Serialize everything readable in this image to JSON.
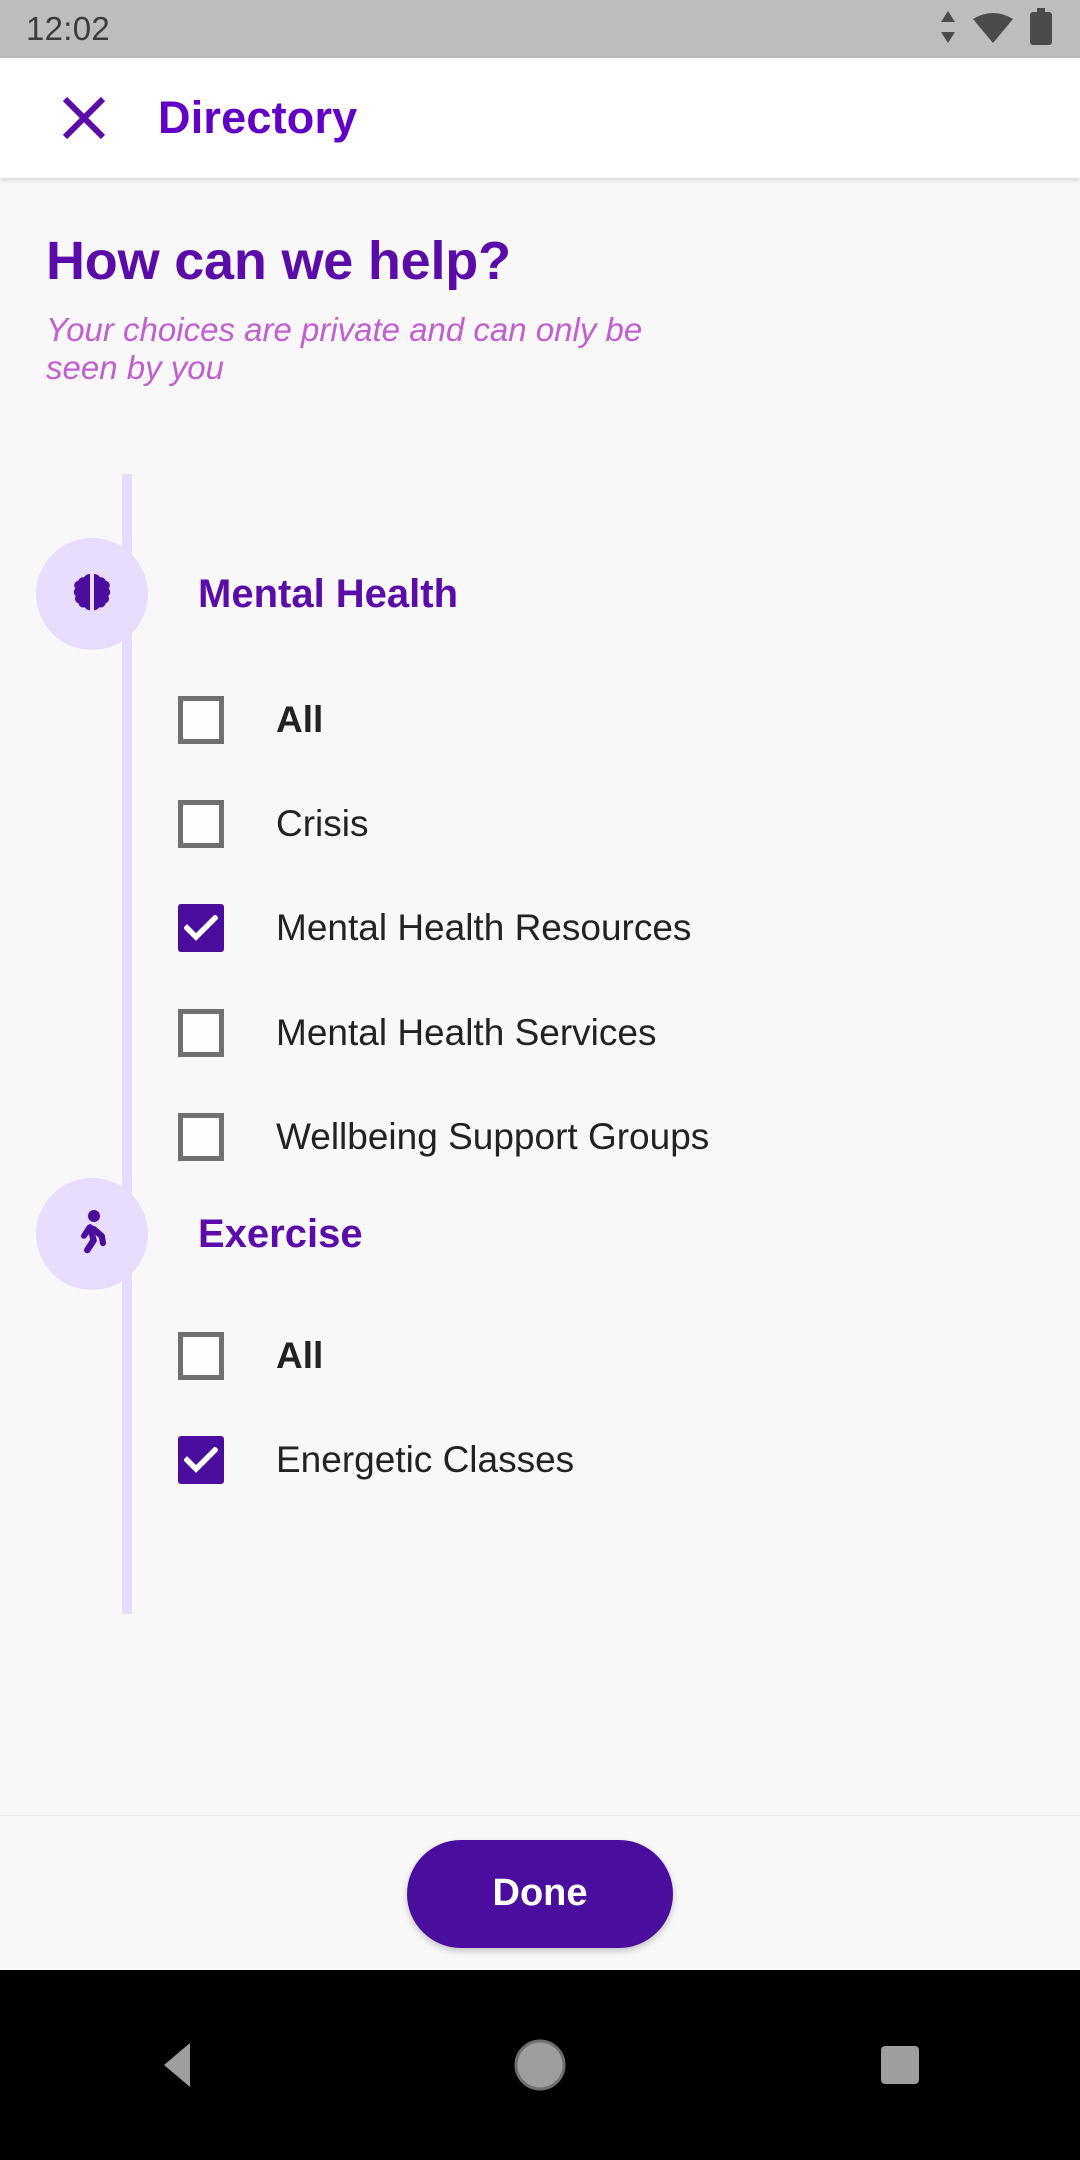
{
  "status_bar": {
    "time": "12:02",
    "icons": [
      "data-transfer-icon",
      "wifi-icon",
      "battery-icon"
    ]
  },
  "app_bar": {
    "close_icon": "close-icon",
    "title": "Directory"
  },
  "page": {
    "heading": "How can we help?",
    "subtitle": "Your choices are private and can only be seen by you"
  },
  "colors": {
    "accent": "#4b0d9e",
    "title_purple": "#6200c8",
    "heading_purple": "#5b0ca8",
    "subtitle_pink": "#c15fd1",
    "bubble_bg": "#e8ddfd",
    "connector": "#e5dcfb",
    "page_bg": "#f8f8f9",
    "checkbox_border": "#70706f"
  },
  "categories": [
    {
      "name": "Mental Health",
      "icon": "brain-icon",
      "options": [
        {
          "label": "All",
          "checked": false,
          "bold": true
        },
        {
          "label": "Crisis",
          "checked": false,
          "bold": false
        },
        {
          "label": "Mental Health Resources",
          "checked": true,
          "bold": false
        },
        {
          "label": "Mental Health Services",
          "checked": false,
          "bold": false
        },
        {
          "label": "Wellbeing Support Groups",
          "checked": false,
          "bold": false
        }
      ]
    },
    {
      "name": "Exercise",
      "icon": "walking-person-icon",
      "options": [
        {
          "label": "All",
          "checked": false,
          "bold": true
        },
        {
          "label": "Energetic Classes",
          "checked": true,
          "bold": false
        }
      ]
    }
  ],
  "footer": {
    "done_label": "Done"
  },
  "nav_bar": {
    "back": "back-triangle-icon",
    "home": "home-circle-icon",
    "recents": "recents-square-icon"
  }
}
